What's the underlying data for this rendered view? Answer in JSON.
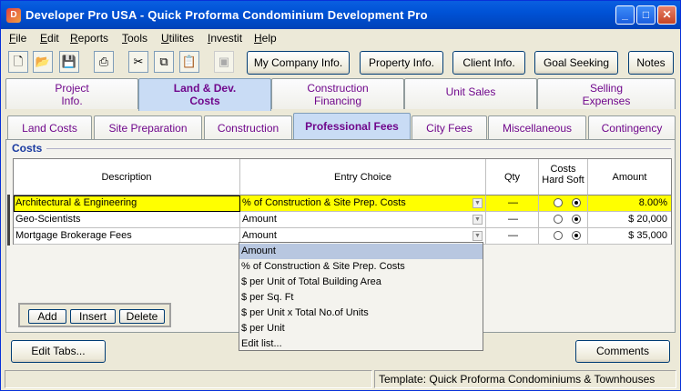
{
  "window": {
    "title": "Developer Pro  USA - Quick Proforma Condominium Development Pro",
    "minimize": "_",
    "maximize": "□",
    "close": "✕"
  },
  "menu": [
    {
      "label": "File",
      "ul": "F",
      "rest": "ile"
    },
    {
      "label": "Edit",
      "ul": "E",
      "rest": "dit"
    },
    {
      "label": "Reports",
      "ul": "R",
      "rest": "eports"
    },
    {
      "label": "Tools",
      "ul": "T",
      "rest": "ools"
    },
    {
      "label": "Utilites",
      "ul": "U",
      "rest": "tilites"
    },
    {
      "label": "Investit",
      "ul": "I",
      "rest": "nvestit"
    },
    {
      "label": "Help",
      "ul": "H",
      "rest": "elp"
    }
  ],
  "toolbar": {
    "icons": [
      "new-file-icon",
      "open-folder-icon",
      "save-disk-icon",
      "print-icon",
      "cut-icon",
      "copy-icon",
      "paste-icon",
      "calculator-icon"
    ],
    "buttons": [
      "My Company Info.",
      "Property Info.",
      "Client Info.",
      "Goal Seeking",
      "Notes"
    ]
  },
  "main_tabs": [
    {
      "line1": "Project",
      "line2": "Info."
    },
    {
      "line1": "Land & Dev.",
      "line2": "Costs"
    },
    {
      "line1": "Construction",
      "line2": "Financing"
    },
    {
      "line1": "Unit Sales",
      "line2": ""
    },
    {
      "line1": "Selling",
      "line2": "Expenses"
    }
  ],
  "sub_tabs": [
    "Land Costs",
    "Site Preparation",
    "Construction",
    "Professional Fees",
    "City  Fees",
    "Miscellaneous",
    "Contingency"
  ],
  "panel": {
    "title": "Costs",
    "columns": {
      "description": "Description",
      "entry_choice": "Entry Choice",
      "qty": "Qty",
      "costs_line1": "Costs",
      "costs_line2": "Hard Soft",
      "amount": "Amount"
    },
    "rows": [
      {
        "description": "Architectural & Engineering",
        "entry": "% of Construction & Site Prep. Costs",
        "qty": "—",
        "hard": false,
        "soft": true,
        "amount": "8.00%"
      },
      {
        "description": "Geo-Scientists",
        "entry": "Amount",
        "qty": "—",
        "hard": false,
        "soft": true,
        "amount": "$ 20,000"
      },
      {
        "description": "Mortgage Brokerage Fees",
        "entry": "Amount",
        "qty": "—",
        "hard": false,
        "soft": true,
        "amount": "$ 35,000"
      }
    ],
    "dropdown_options": [
      "Amount",
      "% of Construction & Site Prep. Costs",
      "$ per Unit of Total Building Area",
      "$ per Sq. Ft",
      "$ per Unit x Total No.of Units",
      "$ per Unit",
      "Edit list..."
    ],
    "actions": {
      "add": "Add",
      "insert": "Insert",
      "delete": "Delete"
    }
  },
  "footer": {
    "edit_tabs": "Edit Tabs...",
    "comments": "Comments",
    "status": "Template: Quick Proforma Condominiums & Townhouses"
  },
  "colors": {
    "selected_row": "#ffff00",
    "tab_text": "#70078c",
    "active_tab": "#c9dcf5"
  }
}
